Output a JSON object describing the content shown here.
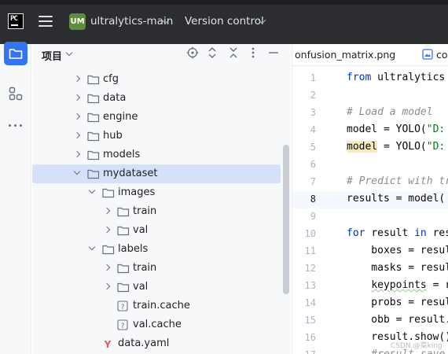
{
  "titlebar": {
    "logo": "PC",
    "project_badge": "UM",
    "project_name": "ultralytics-main",
    "vcs_label": "Version control"
  },
  "toolstrip": {
    "items": [
      {
        "icon": "folder-icon",
        "active": true
      },
      {
        "icon": "structure-icon",
        "active": false
      },
      {
        "icon": "more-icon",
        "active": false
      }
    ]
  },
  "project_panel": {
    "title": "项目",
    "tree": [
      {
        "label": "cfg",
        "type": "folder",
        "expanded": false,
        "level": 0
      },
      {
        "label": "data",
        "type": "folder",
        "expanded": false,
        "level": 0
      },
      {
        "label": "engine",
        "type": "folder",
        "expanded": false,
        "level": 0
      },
      {
        "label": "hub",
        "type": "folder",
        "expanded": false,
        "level": 0
      },
      {
        "label": "models",
        "type": "folder",
        "expanded": false,
        "level": 0
      },
      {
        "label": "mydataset",
        "type": "folder",
        "expanded": true,
        "level": 0,
        "selected": true
      },
      {
        "label": "images",
        "type": "folder",
        "expanded": true,
        "level": 1
      },
      {
        "label": "train",
        "type": "folder",
        "expanded": false,
        "level": 2
      },
      {
        "label": "val",
        "type": "folder",
        "expanded": false,
        "level": 2
      },
      {
        "label": "labels",
        "type": "folder",
        "expanded": true,
        "level": 1
      },
      {
        "label": "train",
        "type": "folder",
        "expanded": false,
        "level": 2
      },
      {
        "label": "val",
        "type": "folder",
        "expanded": false,
        "level": 2
      },
      {
        "label": "train.cache",
        "type": "unknown-file",
        "level": 2
      },
      {
        "label": "val.cache",
        "type": "unknown-file",
        "level": 2
      },
      {
        "label": "data.yaml",
        "type": "yaml-file",
        "level": 1
      }
    ]
  },
  "editor": {
    "tabs": [
      {
        "label": "onfusion_matrix.png"
      },
      {
        "label": "co"
      }
    ],
    "current_line": 8,
    "lines": [
      {
        "n": "1",
        "tokens": [
          {
            "t": "from ",
            "c": "kw"
          },
          {
            "t": "ultralytics",
            "c": ""
          }
        ]
      },
      {
        "n": "2",
        "tokens": []
      },
      {
        "n": "3",
        "tokens": [
          {
            "t": "# Load a model",
            "c": "cm"
          }
        ]
      },
      {
        "n": "4",
        "tokens": [
          {
            "t": "model = YOLO(",
            "c": ""
          },
          {
            "t": "\"D:",
            "c": "st"
          }
        ]
      },
      {
        "n": "5",
        "tokens": [
          {
            "t": "model",
            "c": "warn"
          },
          {
            "t": " = YOLO(",
            "c": ""
          },
          {
            "t": "\"D:",
            "c": "st"
          }
        ]
      },
      {
        "n": "6",
        "tokens": []
      },
      {
        "n": "7",
        "tokens": [
          {
            "t": "# Predict with tr",
            "c": "cm"
          }
        ]
      },
      {
        "n": "8",
        "tokens": [
          {
            "t": "results = model(",
            "c": ""
          }
        ]
      },
      {
        "n": "9",
        "tokens": []
      },
      {
        "n": "10",
        "tokens": [
          {
            "t": "for ",
            "c": "kw"
          },
          {
            "t": "result ",
            "c": ""
          },
          {
            "t": "in ",
            "c": "kw"
          },
          {
            "t": "res",
            "c": ""
          }
        ]
      },
      {
        "n": "11",
        "tokens": [
          {
            "t": "    boxes = resul",
            "c": ""
          }
        ]
      },
      {
        "n": "12",
        "tokens": [
          {
            "t": "    masks = resul",
            "c": ""
          }
        ]
      },
      {
        "n": "13",
        "tokens": [
          {
            "t": "    ",
            "c": ""
          },
          {
            "t": "keypoints",
            "c": "squig"
          },
          {
            "t": " = r",
            "c": ""
          }
        ]
      },
      {
        "n": "14",
        "tokens": [
          {
            "t": "    probs = resul",
            "c": ""
          }
        ]
      },
      {
        "n": "15",
        "tokens": [
          {
            "t": "    obb = result.",
            "c": ""
          }
        ]
      },
      {
        "n": "16",
        "tokens": [
          {
            "t": "    result.show()",
            "c": ""
          }
        ]
      },
      {
        "n": "17",
        "tokens": [
          {
            "t": "    #result.save",
            "c": "cm"
          }
        ]
      }
    ]
  },
  "watermark": "CSDN @菜king"
}
